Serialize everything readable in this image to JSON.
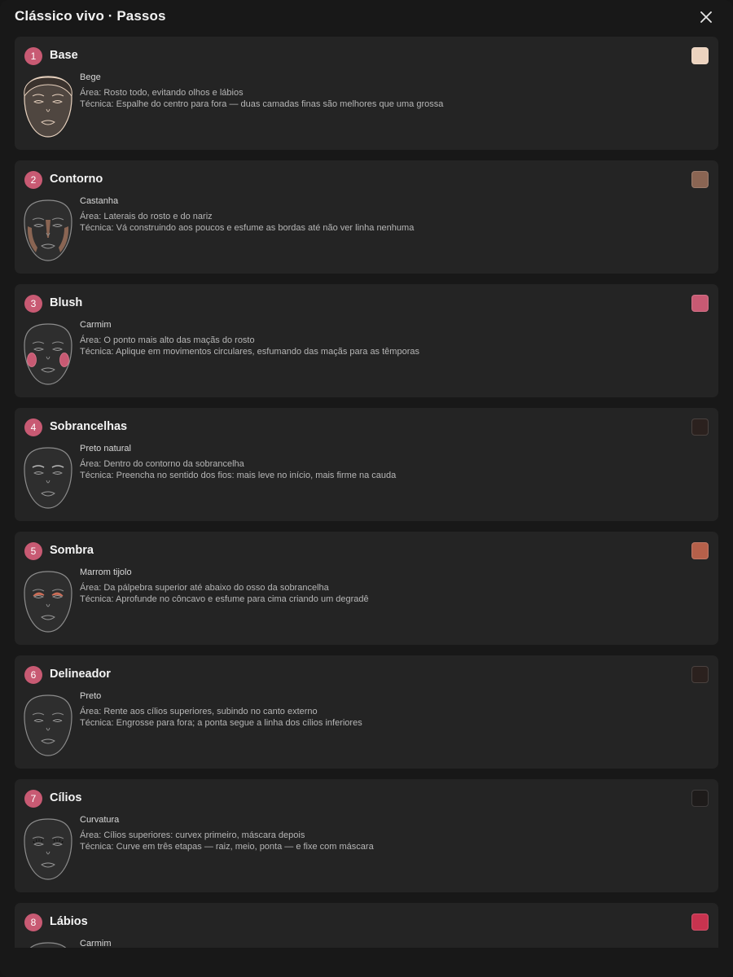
{
  "header": {
    "title": "Clássico vivo · Passos",
    "close_icon": "close-icon"
  },
  "colors": {
    "badge": "#c85a73",
    "card": "#242424",
    "background": "#181818"
  },
  "steps": [
    {
      "number": "1",
      "title": "Base",
      "shade": "Bege",
      "area": "Área: Rosto todo, evitando olhos e lábios",
      "technique": "Técnica: Espalhe do centro para fora — duas camadas finas são melhores que uma grossa",
      "swatch": "#ecd3bf",
      "highlight": "face"
    },
    {
      "number": "2",
      "title": "Contorno",
      "shade": "Castanha",
      "area": "Área: Laterais do rosto e do nariz",
      "technique": "Técnica: Vá construindo aos poucos e esfume as bordas até não ver linha nenhuma",
      "swatch": "#8a6553",
      "highlight": "contour"
    },
    {
      "number": "3",
      "title": "Blush",
      "shade": "Carmim",
      "area": "Área: O ponto mais alto das maçãs do rosto",
      "technique": "Técnica: Aplique em movimentos circulares, esfumando das maçãs para as têmporas",
      "swatch": "#c85a73",
      "highlight": "cheeks"
    },
    {
      "number": "4",
      "title": "Sobrancelhas",
      "shade": "Preto natural",
      "area": "Área: Dentro do contorno da sobrancelha",
      "technique": "Técnica: Preencha no sentido dos fios: mais leve no início, mais firme na cauda",
      "swatch": "#2b211e",
      "highlight": "brows"
    },
    {
      "number": "5",
      "title": "Sombra",
      "shade": "Marrom tijolo",
      "area": "Área: Da pálpebra superior até abaixo do osso da sobrancelha",
      "technique": "Técnica: Aprofunde no côncavo e esfume para cima criando um degradê",
      "swatch": "#b5604a",
      "highlight": "lids"
    },
    {
      "number": "6",
      "title": "Delineador",
      "shade": "Preto",
      "area": "Área: Rente aos cílios superiores, subindo no canto externo",
      "technique": "Técnica: Engrosse para fora; a ponta segue a linha dos cílios inferiores",
      "swatch": "#2b211e",
      "highlight": "liner"
    },
    {
      "number": "7",
      "title": "Cílios",
      "shade": "Curvatura",
      "area": "Área: Cílios superiores: curvex primeiro, máscara depois",
      "technique": "Técnica: Curve em três etapas — raiz, meio, ponta — e fixe com máscara",
      "swatch": "#1e1b1a",
      "highlight": "lashes"
    },
    {
      "number": "8",
      "title": "Lábios",
      "shade": "Carmim",
      "area": "",
      "technique": "",
      "swatch": "#c8334f",
      "highlight": "lips"
    }
  ]
}
